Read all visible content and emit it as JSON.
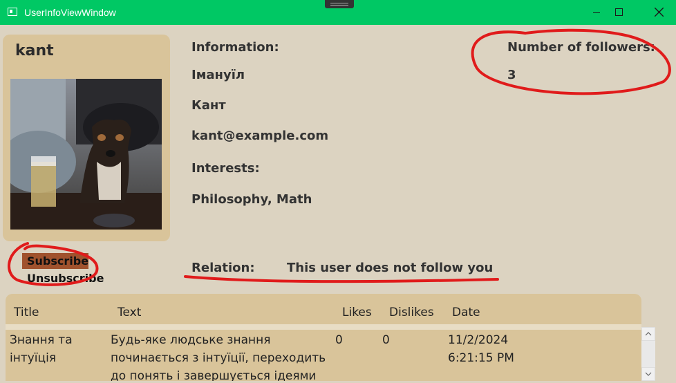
{
  "window": {
    "title": "UserInfoViewWindow"
  },
  "profile": {
    "username": "kant",
    "photo_description": "photo-icon"
  },
  "info": {
    "heading": "Information:",
    "first_name": "Іманyїл",
    "last_name": "Кант",
    "email": "kant@example.com",
    "interests_label": "Interests:",
    "interests": "Philosophy, Math"
  },
  "followers": {
    "label": "Number of followers:",
    "count": "3"
  },
  "relation": {
    "label": "Relation:",
    "value": "This user does not follow you"
  },
  "actions": {
    "subscribe": "Subscribe",
    "unsubscribe": "Unsubscribe"
  },
  "posts": {
    "columns": [
      "Title",
      "Text",
      "Likes",
      "Dislikes",
      "Date"
    ],
    "rows": [
      {
        "title_line1": "Знання та",
        "title_line2": "інтуїція",
        "text_line1": "Будь-яке людське знання",
        "text_line2": "починається з інтуїції, переходить",
        "text_line3": "до понять і завершується ідеями",
        "likes": "0",
        "dislikes": "0",
        "date_line1": "11/2/2024",
        "date_line2": "6:21:15 PM"
      }
    ]
  },
  "colors": {
    "titlebar": "#00c864",
    "background": "#dcd3c1",
    "card": "#d9c49a",
    "subscribe_button": "#a0522d",
    "annotation": "#e01b1b"
  }
}
